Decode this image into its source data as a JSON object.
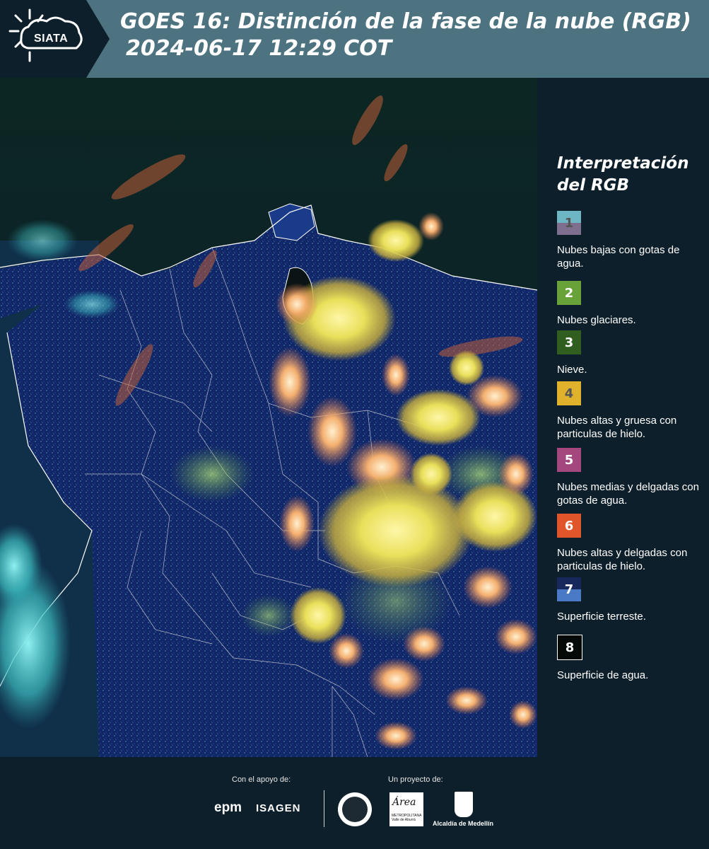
{
  "header": {
    "logo_text": "SIATA",
    "title_line1": "GOES 16: Distinción de la fase de la nube (RGB)",
    "title_line2": "2024-06-17 12:29 COT",
    "bg_color": "#4d7380"
  },
  "legend": {
    "title_line1": "Interpretación",
    "title_line2": "del RGB",
    "items": [
      {
        "number": "1",
        "label": "Nubes bajas con gotas de agua.",
        "color_top": "#6fb6c4",
        "color_bottom": "#7e6f8f",
        "number_color": "#555555"
      },
      {
        "number": "2",
        "label": "Nubes glaciares.",
        "color": "#6aa23a",
        "number_color": "#ffffff"
      },
      {
        "number": "3",
        "label": "Nieve.",
        "color": "#2f5e1e",
        "number_color": "#ffffff"
      },
      {
        "number": "4",
        "label": "Nubes altas y gruesa con particulas de hielo.",
        "color": "#e0b12b",
        "number_color": "#555555"
      },
      {
        "number": "5",
        "label": "Nubes medias y delgadas con gotas de agua.",
        "color": "#a3477e",
        "number_color": "#ffffff"
      },
      {
        "number": "6",
        "label": "Nubes altas y delgadas con particulas de hielo.",
        "color": "#e1552a",
        "number_color": "#ffffff"
      },
      {
        "number": "7",
        "label": "Superficie terreste.",
        "color_top": "#16285c",
        "color_bottom": "#4a79c6",
        "number_color": "#ffffff"
      },
      {
        "number": "8",
        "label": "Superficie de agua.",
        "color": "#050a08",
        "number_color": "#ffffff"
      }
    ]
  },
  "footer": {
    "support_label": "Con el apoyo de:",
    "project_label": "Un proyecto de:",
    "sponsors": [
      "epm",
      "ISAGEN"
    ],
    "partners": [
      "Área Metropolitana Valle de Aburrá",
      "Alcaldía de Medellín"
    ],
    "area_logo_text": "Área",
    "area_logo_sub": "METROPOLITANA Valle de Aburrá",
    "alcaldia_text": "Alcaldía de Medellín"
  }
}
